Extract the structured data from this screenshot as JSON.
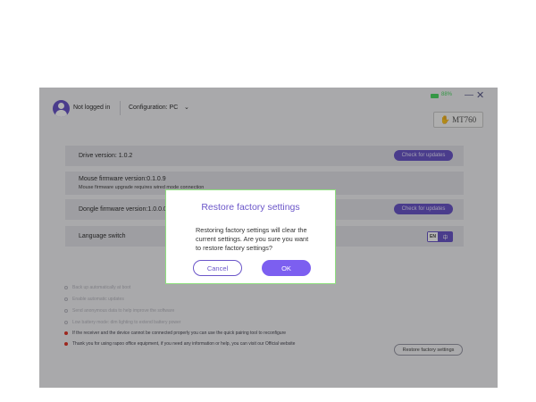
{
  "header": {
    "login_status": "Not logged in",
    "configuration": "Configuration: PC",
    "battery_text": "88%",
    "model": "MT760"
  },
  "settings": {
    "drive": {
      "label": "Drive version: 1.0.2",
      "button": "Check for updates"
    },
    "mouse": {
      "label": "Mouse firmware version:0.1.0.9",
      "sublabel": "Mouse firmware upgrade requires wired mode connection"
    },
    "dongle": {
      "label": "Dongle firmware version:1.0.0.0",
      "button": "Check for updates"
    },
    "language": {
      "label": "Language switch",
      "options": [
        "EN",
        "中"
      ],
      "selected": "EN"
    }
  },
  "notes": [
    "Back up automatically at boot",
    "Enable automatic updates",
    "Send anonymous data to help improve the software",
    "Low battery mode: dim lighting to extend battery power",
    "If the receiver and the device cannot be connected properly you can use the quick pairing tool to reconfigure",
    "Thank you for using rapoo office equipment, if you need any information or help, you can visit our Official website"
  ],
  "note_links": [
    "the quick pairing tool",
    "Official website"
  ],
  "restore_button": "Restore factory settings",
  "dialog": {
    "title": "Restore factory settings",
    "message": "Restoring factory settings will clear the current settings. Are you sure you want to restore factory settings?",
    "cancel": "Cancel",
    "ok": "OK"
  },
  "colors": {
    "accent": "#6b56c9",
    "ok_button": "#7c5ff0",
    "dialog_border": "#8fe07f",
    "battery": "#4cd964",
    "note_dot": "#e0392b"
  },
  "icons": [
    "user-icon",
    "chevron-down-icon",
    "minimize-icon",
    "close-icon",
    "mouse-icon",
    "battery-icon"
  ]
}
